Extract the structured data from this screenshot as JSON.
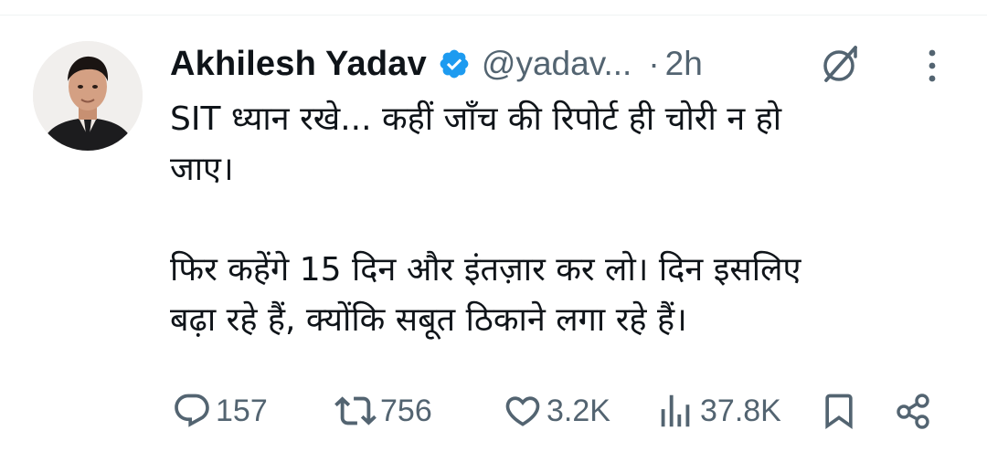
{
  "tweet": {
    "author": {
      "name": "Akhilesh Yadav",
      "handle": "@yadav...",
      "verified": true,
      "avatar": "profile-photo"
    },
    "separator": "·",
    "time": "2h",
    "lines": [
      "SIT ध्यान रखे... कहीं जाँच की रिपोर्ट ही चोरी न हो",
      "जाए।",
      "फिर कहेंगे 15 दिन और इंतज़ार कर लो। दिन इसलिए",
      "बढ़ा रहे हैं, क्योंकि सबूत ठिकाने लगा रहे हैं।"
    ],
    "actions": {
      "replies": "157",
      "reposts": "756",
      "likes": "3.2K",
      "views": "37.8K"
    },
    "icons": [
      "grok-icon",
      "more-icon",
      "reply-icon",
      "repost-icon",
      "like-icon",
      "views-icon",
      "bookmark-icon",
      "share-icon",
      "verified-badge-icon"
    ]
  },
  "colors": {
    "text_primary": "#0f1419",
    "text_secondary": "#536471",
    "verified_blue": "#1d9bf0",
    "background": "#ffffff"
  }
}
